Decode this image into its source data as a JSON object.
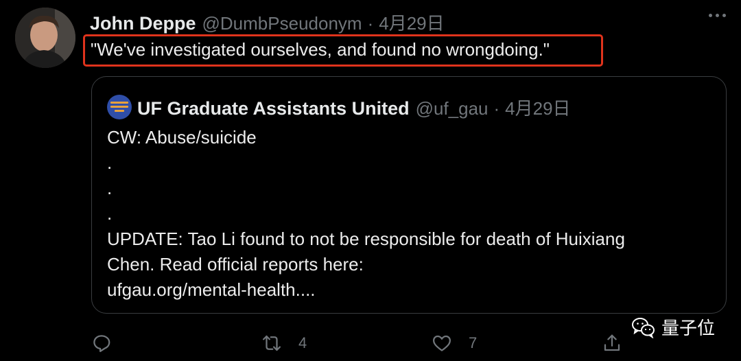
{
  "tweet": {
    "author_name": "John Deppe",
    "author_handle": "@DumbPseudonym",
    "separator": "·",
    "date": "4月29日",
    "text": "\"We've investigated ourselves, and found no wrongdoing.\"",
    "highlight_color": "#e0331c"
  },
  "quoted_tweet": {
    "author_name": "UF Graduate Assistants United",
    "author_handle": "@uf_gau",
    "separator": "·",
    "date": "4月29日",
    "lines": [
      "CW: Abuse/suicide",
      ".",
      ".",
      ".",
      "UPDATE: Tao Li found to not be responsible for death of Huixiang",
      "Chen. Read official reports here:",
      "ufgau.org/mental-health...."
    ]
  },
  "actions": {
    "reply_icon": "reply-icon",
    "retweet_icon": "retweet-icon",
    "retweet_count": "4",
    "like_icon": "heart-icon",
    "like_count": "7",
    "share_icon": "share-icon"
  },
  "watermark": {
    "text": "量子位",
    "icon": "wechat-icon"
  }
}
